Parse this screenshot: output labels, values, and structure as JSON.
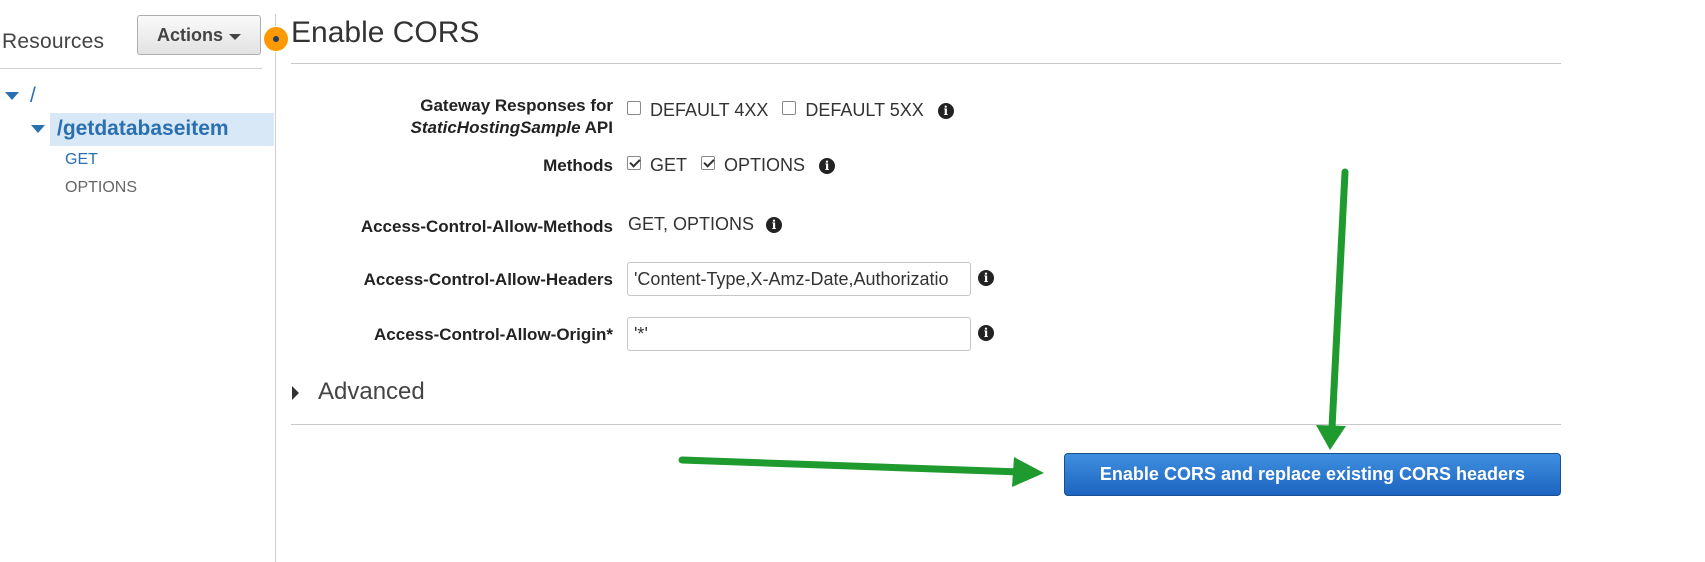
{
  "sidebar": {
    "title": "Resources",
    "actions_label": "Actions",
    "tree": {
      "root_label": "/",
      "resource_label": "/getdatabaseitem",
      "methods": [
        "GET",
        "OPTIONS"
      ]
    }
  },
  "main": {
    "title": "Enable CORS",
    "gateway_responses": {
      "label_line1": "Gateway Responses for",
      "label_api_name": "StaticHostingSample",
      "label_api_suffix": " API",
      "options": [
        {
          "label": "DEFAULT 4XX",
          "checked": false
        },
        {
          "label": "DEFAULT 5XX",
          "checked": false
        }
      ]
    },
    "methods": {
      "label": "Methods",
      "options": [
        {
          "label": "GET",
          "checked": true
        },
        {
          "label": "OPTIONS",
          "checked": true
        }
      ]
    },
    "allow_methods": {
      "label": "Access-Control-Allow-Methods",
      "value": "GET, OPTIONS"
    },
    "allow_headers": {
      "label": "Access-Control-Allow-Headers",
      "value": "'Content-Type,X-Amz-Date,Authorizatio"
    },
    "allow_origin": {
      "label": "Access-Control-Allow-Origin*",
      "value": "'*'"
    },
    "advanced_label": "Advanced",
    "submit_label": "Enable CORS and replace existing CORS headers"
  },
  "colors": {
    "link_blue": "#2a6fb0",
    "selected_row": "#d9e8f6",
    "primary_button": "#1d64c1",
    "status_dot": "#ff9900",
    "annotation_arrow": "#1f9a2e"
  },
  "icons": [
    "info-icon",
    "caret-down-icon",
    "expand-triangle-icon",
    "status-dot-icon"
  ]
}
